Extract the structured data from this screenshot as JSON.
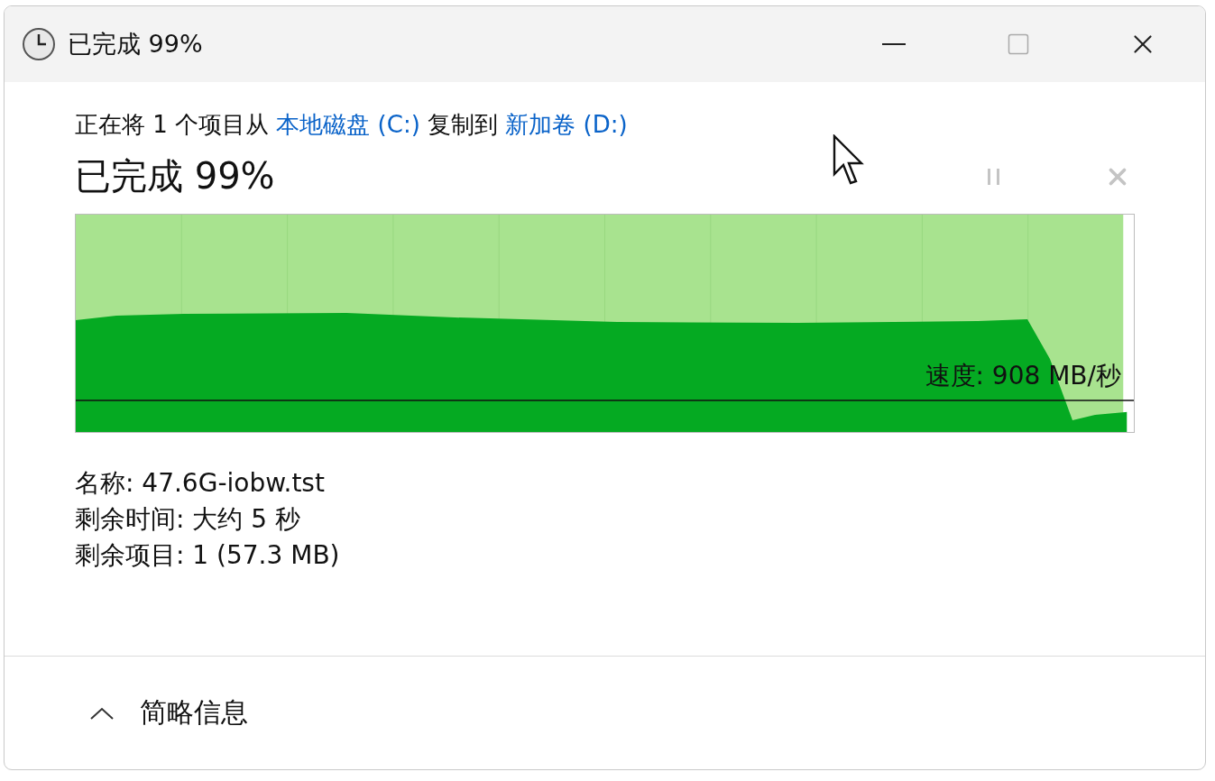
{
  "window": {
    "title": "已完成 99%"
  },
  "copy_line": [
    {
      "kind": "text",
      "text": "正在将 1 个项目从"
    },
    {
      "kind": "link",
      "text": "本地磁盘 (C:)"
    },
    {
      "kind": "text",
      "text": "复制到"
    },
    {
      "kind": "link",
      "text": "新加卷 (D:)"
    }
  ],
  "status": "已完成 99%",
  "progress": {
    "level": 0.99,
    "speed": "速度: 908 MB/秒"
  },
  "details": [
    "名称: 47.6G-iobw.tst",
    "剩余时间: 大约 5 秒",
    "剩余项目: 1 (57.3 MB)"
  ],
  "summary_toggle": {
    "label": "简略信息",
    "expanded": true
  }
}
